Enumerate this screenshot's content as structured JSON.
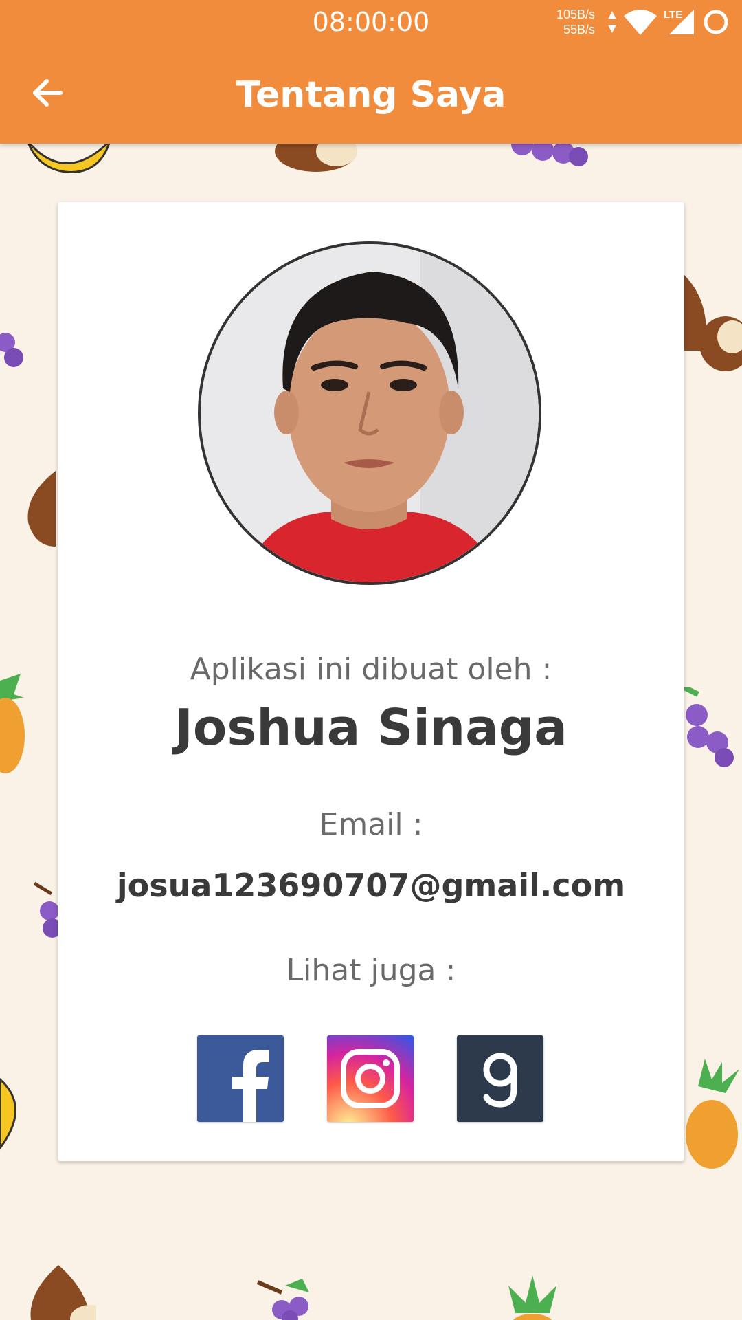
{
  "status_bar": {
    "time": "08:00:00",
    "net_up": "105B/s",
    "net_down": "55B/s",
    "network_type": "LTE"
  },
  "app_bar": {
    "title": "Tentang Saya",
    "back_icon": "arrow-back-icon"
  },
  "profile": {
    "photo_icon": "profile-photo",
    "made_by_label": "Aplikasi ini dibuat oleh :",
    "name": "Joshua Sinaga",
    "email_label": "Email :",
    "email": "josua123690707@gmail.com",
    "see_also_label": "Lihat juga :"
  },
  "socials": [
    {
      "name": "facebook",
      "icon": "facebook-icon",
      "color": "#3b5998"
    },
    {
      "name": "instagram",
      "icon": "instagram-icon",
      "color": "#d6249f"
    },
    {
      "name": "9gag",
      "icon": "9gag-icon",
      "color": "#2c3a4b"
    }
  ],
  "colors": {
    "primary": "#f08c3c",
    "background": "#faf2e6",
    "card": "#ffffff",
    "text_dark": "#3a3a3a",
    "text_muted": "#6a6a6a"
  }
}
